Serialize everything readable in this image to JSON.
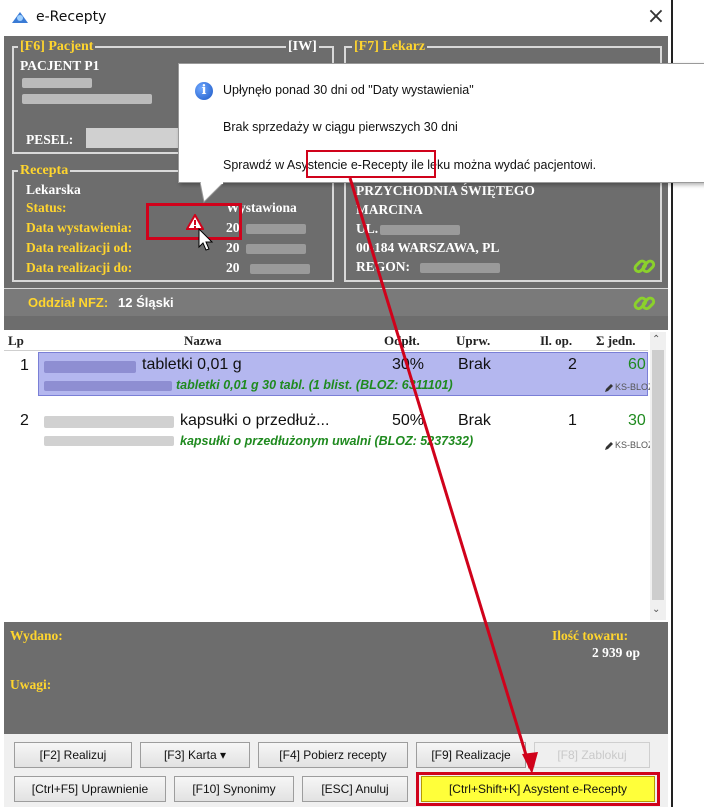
{
  "window": {
    "title": "e-Recepty",
    "close": "×"
  },
  "patient": {
    "legend": "[F6] Pacjent",
    "iw": "[IW]",
    "name": "PACJENT P1",
    "pesel_label": "PESEL:"
  },
  "doctor": {
    "legend": "[F7] Lekarz"
  },
  "prescription": {
    "legend": "Recepta",
    "type": "Lekarska",
    "status_label": "Status:",
    "status_value": "Wystawiona",
    "issued_label": "Data wystawienia:",
    "issued_value": "20",
    "from_label": "Data realizacji od:",
    "from_value": "20",
    "to_label": "Data realizacji do:",
    "to_value": "20"
  },
  "clinic": {
    "name1": "PRZYCHODNIA ŚWIĘTEGO",
    "name2": "MARCINA",
    "street_prefix": "UL.",
    "city": "00-184 WARSZAWA, PL",
    "regon_label": "REGON:"
  },
  "nfz": {
    "label": "Oddział NFZ:",
    "value": "12 Śląski"
  },
  "tooltip": {
    "line1": "Upłynęło ponad 30 dni od \"Daty wystawienia\"",
    "line2": "Brak sprzedaży w ciągu pierwszych 30 dni",
    "line3": "Sprawdź w Asystencie e-Recepty ile leku można wydać pacjentowi."
  },
  "list": {
    "columns": {
      "lp": "Lp",
      "name": "Nazwa",
      "refund": "Odpłt.",
      "entitlement": "Uprw.",
      "packs": "Il. op.",
      "units": "Σ jedn."
    },
    "rows": [
      {
        "lp": "1",
        "name": "tabletki 0,01 g",
        "refund": "30%",
        "entitlement": "Brak",
        "packs": "2",
        "units": "60",
        "detail": "tabletki 0,01 g 30 tabl. (1 blist. (BLOZ: 6311101)",
        "tag": "KS-BLOZ"
      },
      {
        "lp": "2",
        "name": "kapsułki o przedłuż...",
        "refund": "50%",
        "entitlement": "Brak",
        "packs": "1",
        "units": "30",
        "detail": "kapsułki o przedłużonym uwalni (BLOZ: 5237332)",
        "tag": "KS-BLOZ"
      }
    ]
  },
  "summary": {
    "issued_label": "Wydano:",
    "qty_label": "Ilość towaru:",
    "qty_value": "2 939 op",
    "notes_label": "Uwagi:"
  },
  "buttons": {
    "realize": "[F2] Realizuj",
    "card": "[F3] Karta ▾",
    "fetch": "[F4] Pobierz recepty",
    "realizations": "[F9] Realizacje",
    "block": "[F8] Zablokuj",
    "rights": "[Ctrl+F5] Uprawnienie",
    "synonyms": "[F10] Synonimy",
    "cancel": "[ESC] Anuluj",
    "assistant": "[Ctrl+Shift+K] Asystent e-Recepty"
  },
  "colors": {
    "panel": "#6d6d6d",
    "legend_yellow": "#ffd52e",
    "highlight_red": "#d0021b",
    "selection": "#b4b7ef",
    "green_text": "#1f8a1f"
  },
  "icons": [
    "app-icon",
    "info-icon",
    "warning-icon",
    "link-icon",
    "scroll-up-icon",
    "scroll-down-icon",
    "pencil-icon",
    "cursor-icon"
  ]
}
